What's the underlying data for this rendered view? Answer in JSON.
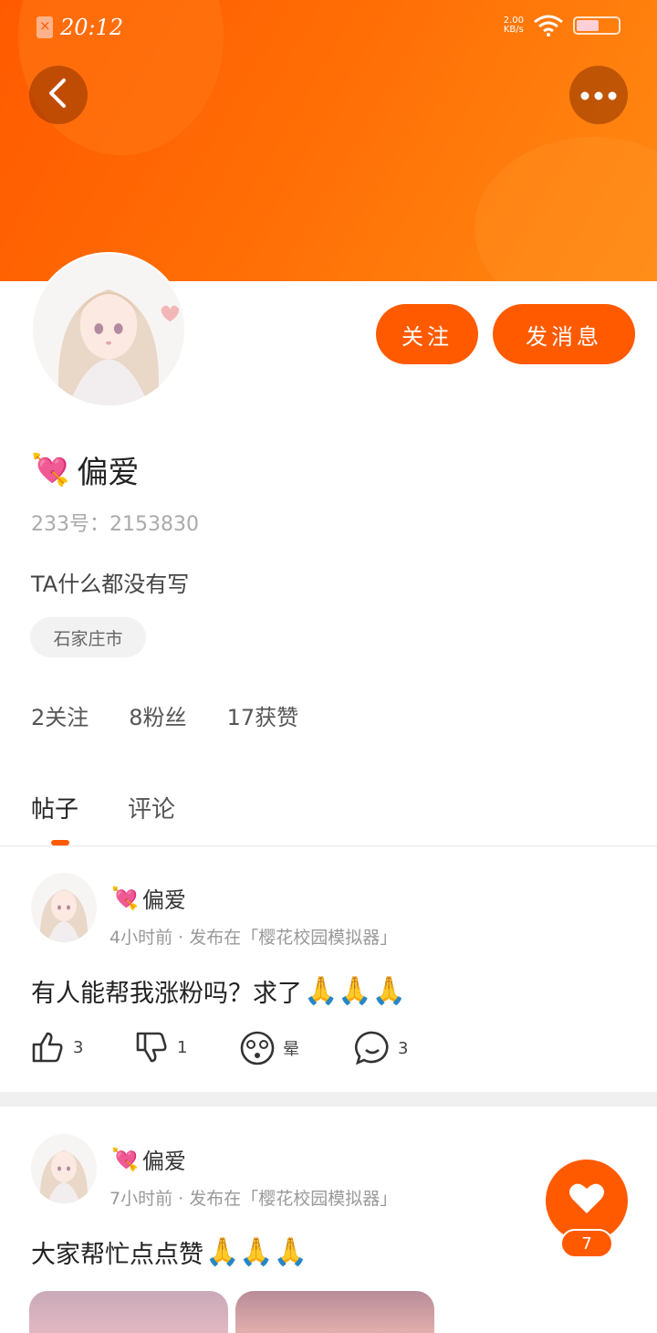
{
  "status_bar": {
    "time": "20:12",
    "net_speed_value": "2.00",
    "net_speed_unit": "KB/s"
  },
  "header": {
    "back_icon": "chevron-left-icon",
    "more_icon": "ellipsis-icon",
    "gradient_colors": [
      "#ff5a00",
      "#ff8a12"
    ]
  },
  "profile": {
    "follow_label": "关注",
    "message_label": "发消息",
    "username": "偏爱",
    "username_emoji": "💘",
    "id_text": "233号：2153830",
    "bio": "TA什么都没有写",
    "location": "石家庄市",
    "stats": [
      {
        "text": "2关注"
      },
      {
        "text": "8粉丝"
      },
      {
        "text": "17获赞"
      }
    ]
  },
  "tabs": [
    {
      "label": "帖子",
      "active": true
    },
    {
      "label": "评论",
      "active": false
    }
  ],
  "posts": [
    {
      "author": "偏爱",
      "author_emoji": "💘",
      "meta": "4小时前 · 发布在「樱花校园模拟器」",
      "text": "有人能帮我涨粉吗？求了",
      "text_emoji": "🙏🙏🙏",
      "actions": {
        "like_count": "3",
        "dislike_count": "1",
        "dizzy_label": "晕",
        "comment_count": "3"
      }
    },
    {
      "author": "偏爱",
      "author_emoji": "💘",
      "meta": "7小时前 · 发布在「樱花校园模拟器」",
      "text": "大家帮忙点点赞",
      "text_emoji": "🙏🙏🙏"
    }
  ],
  "fab": {
    "icon": "heart-icon",
    "count": "7"
  },
  "accent_color": "#ff5a00"
}
